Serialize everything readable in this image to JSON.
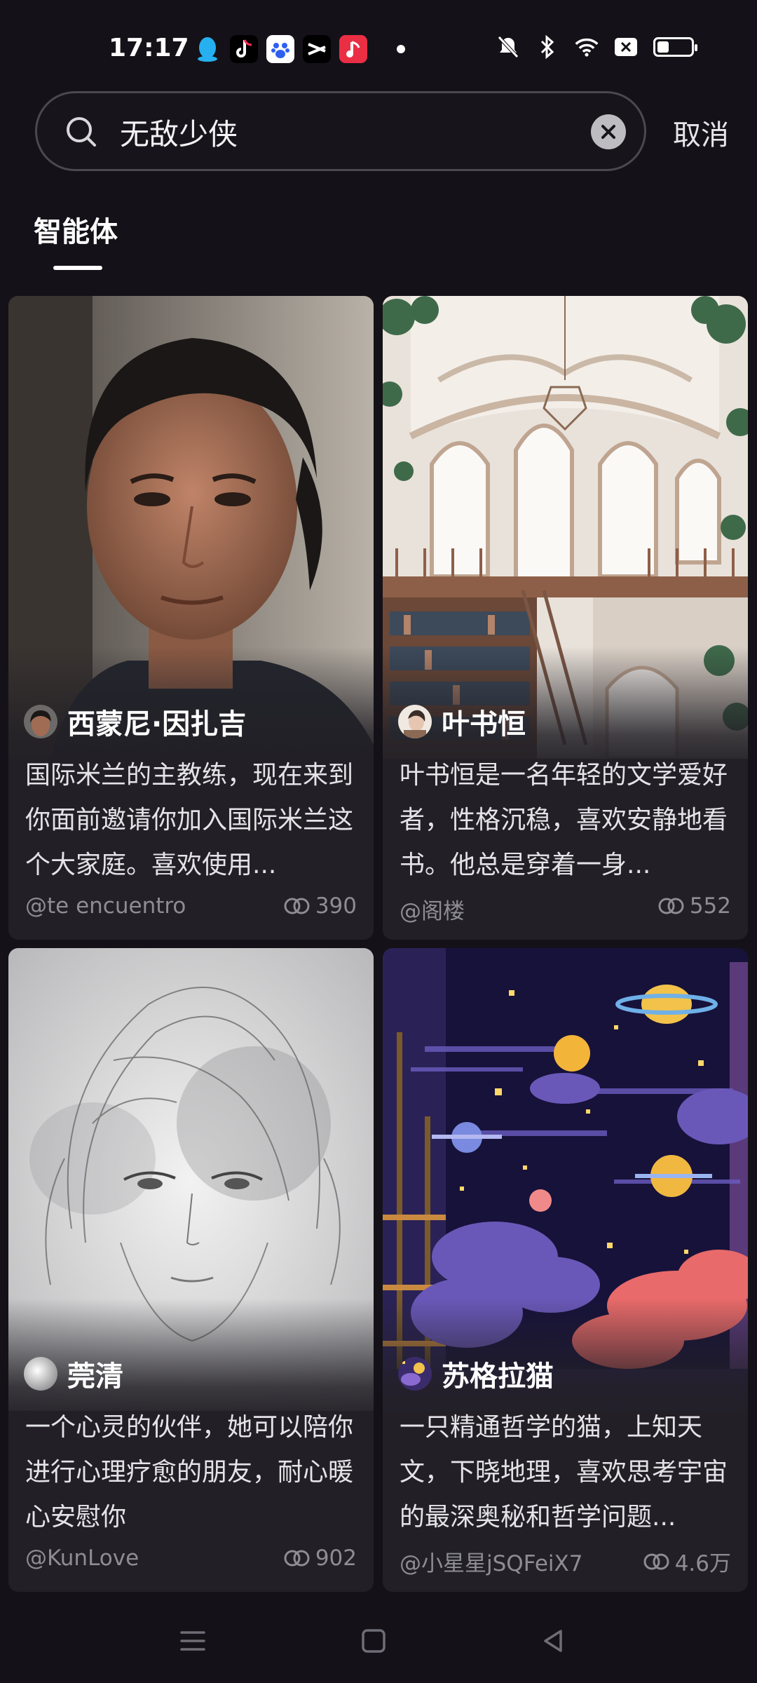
{
  "status": {
    "time": "17:17"
  },
  "search": {
    "query": "无敌少侠",
    "cancel_label": "取消"
  },
  "tabs": [
    {
      "label": "智能体",
      "active": true
    }
  ],
  "cards": [
    {
      "name": "西蒙尼·因扎吉",
      "description": "国际米兰的主教练，现在来到你面前邀请你加入国际米兰这个大家庭。喜欢使用...",
      "author": "@te encuentro",
      "count": "390"
    },
    {
      "name": "叶书恒",
      "description": "叶书恒是一名年轻的文学爱好者，性格沉稳，喜欢安静地看书。他总是穿着一身...",
      "author": "@阁楼",
      "count": "552"
    },
    {
      "name": "莞清",
      "description": "一个心灵的伙伴，她可以陪你进行心理疗愈的朋友，耐心暖心安慰你",
      "author": "@KunLove",
      "count": "902"
    },
    {
      "name": "苏格拉猫",
      "description": "一只精通哲学的猫，上知天文，下晓地理，喜欢思考宇宙的最深奥秘和哲学问题...",
      "author": "@小星星jSQFeiX7",
      "count": "4.6万"
    }
  ],
  "colors": {
    "background": "#141218",
    "card": "#222026",
    "muted_text": "#8e8c94"
  }
}
